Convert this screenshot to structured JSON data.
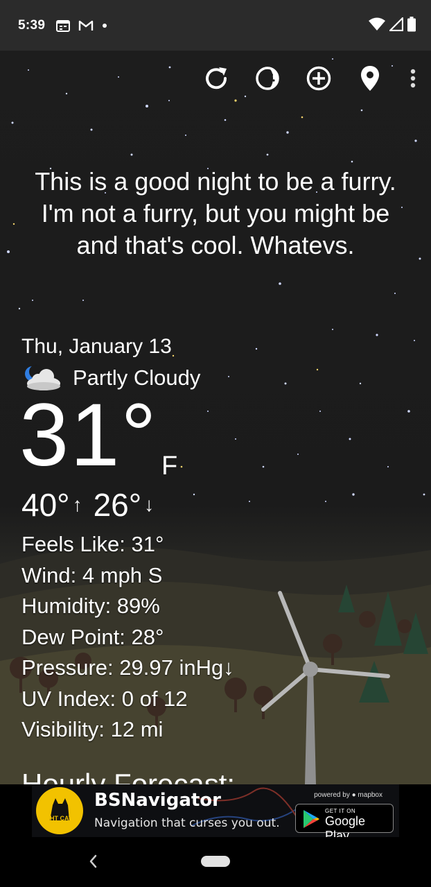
{
  "status_bar": {
    "time": "5:39",
    "left_icons": [
      "calendar-icon",
      "gmail-icon",
      "dot-icon"
    ],
    "right_icons": [
      "wifi-icon",
      "signal-icon",
      "battery-icon"
    ]
  },
  "toolbar": {
    "buttons": [
      "refresh-icon",
      "moon-phase-icon",
      "add-location-icon",
      "location-pin-icon",
      "more-vert-icon"
    ]
  },
  "quote": "This is a good night to be a furry. I'm not a furry, but you might be and that's cool. Whatevs.",
  "current": {
    "date": "Thu, January 13",
    "condition": "Partly Cloudy",
    "condition_icon": "partly-cloudy-night-icon",
    "temperature": "31°",
    "unit": "F",
    "high": "40°",
    "high_arrow": "↑",
    "low": "26°",
    "low_arrow": "↓"
  },
  "details": {
    "feels_like": "Feels Like:  31°",
    "wind": "Wind:  4 mph S",
    "humidity": "Humidity:  89%",
    "dew_point": "Dew Point:  28°",
    "pressure": "Pressure:  29.97 inHg↓",
    "uv_index": "UV Index:  0 of 12",
    "visibility": "Visibility:  12 mi"
  },
  "hourly_title": "Hourly Forecast:",
  "ad": {
    "title": "BSNavigator",
    "subtitle": "Navigation that curses you out.",
    "brand": "NIGHT CAT",
    "powered_by": "powered by ● mapbox",
    "store_small": "GET IT ON",
    "store_big": "Google Play"
  },
  "colors": {
    "sky": "#1b1b1b",
    "accent_moon": "#2f7de1",
    "ad_yellow": "#f2c200"
  }
}
